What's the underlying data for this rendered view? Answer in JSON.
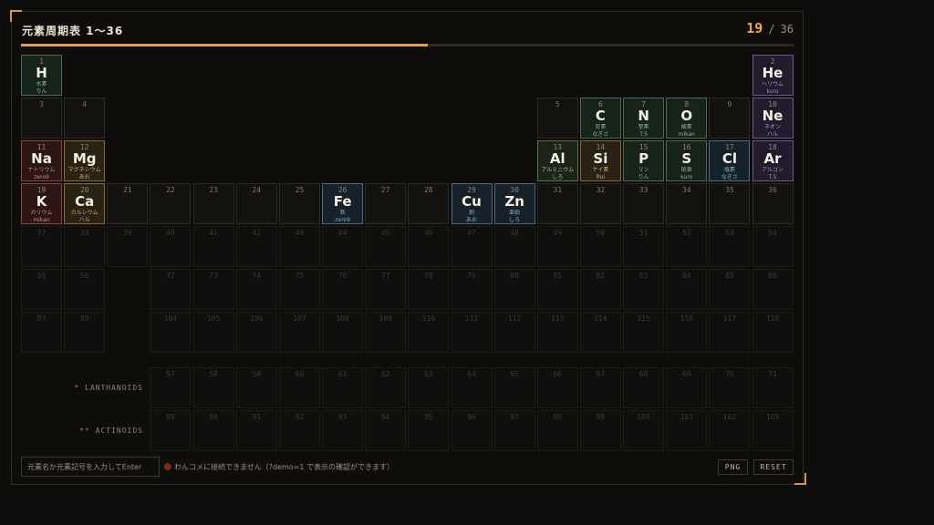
{
  "header": {
    "title": "元素周期表 1〜36",
    "counter_current": "19",
    "counter_sep": "/",
    "counter_total": "36",
    "progress": 0.527
  },
  "colors": {
    "accent": "#e2a24e",
    "nonmetal": "#4a6b52",
    "noble": "#6a5a8a",
    "alkali": "#8a4840",
    "alkaline": "#8a6c3a",
    "transition": "#4e6880",
    "halogen": "#4a7480"
  },
  "elements": [
    {
      "n": "1",
      "sym": "H",
      "jp": "水素",
      "who": "りん",
      "cat": "nonmetal"
    },
    {
      "n": "2",
      "sym": "He",
      "jp": "ヘリウム",
      "who": "kuro",
      "cat": "noble"
    },
    {
      "n": "3",
      "sym": "",
      "jp": "",
      "who": "",
      "cat": ""
    },
    {
      "n": "4",
      "sym": "",
      "jp": "",
      "who": "",
      "cat": ""
    },
    {
      "n": "5",
      "sym": "",
      "jp": "",
      "who": "",
      "cat": ""
    },
    {
      "n": "6",
      "sym": "C",
      "jp": "炭素",
      "who": "なぎさ",
      "cat": "nonmetal"
    },
    {
      "n": "7",
      "sym": "N",
      "jp": "窒素",
      "who": "T.S",
      "cat": "nonmetal"
    },
    {
      "n": "8",
      "sym": "O",
      "jp": "酸素",
      "who": "mikan",
      "cat": "nonmetal"
    },
    {
      "n": "9",
      "sym": "",
      "jp": "",
      "who": "",
      "cat": ""
    },
    {
      "n": "10",
      "sym": "Ne",
      "jp": "ネオン",
      "who": "ハル",
      "cat": "noble"
    },
    {
      "n": "11",
      "sym": "Na",
      "jp": "ナトリウム",
      "who": "zero9",
      "cat": "alkali"
    },
    {
      "n": "12",
      "sym": "Mg",
      "jp": "マグネシウム",
      "who": "あお",
      "cat": "alkaline"
    },
    {
      "n": "13",
      "sym": "Al",
      "jp": "アルミニウム",
      "who": "しろ",
      "cat": "poor"
    },
    {
      "n": "14",
      "sym": "Si",
      "jp": "ケイ素",
      "who": "Rui",
      "cat": "metalloid"
    },
    {
      "n": "15",
      "sym": "P",
      "jp": "リン",
      "who": "りん",
      "cat": "nonmetal"
    },
    {
      "n": "16",
      "sym": "S",
      "jp": "硫黄",
      "who": "kuro",
      "cat": "nonmetal"
    },
    {
      "n": "17",
      "sym": "Cl",
      "jp": "塩素",
      "who": "なぎさ",
      "cat": "halogen"
    },
    {
      "n": "18",
      "sym": "Ar",
      "jp": "アルゴン",
      "who": "T.S",
      "cat": "noble"
    },
    {
      "n": "19",
      "sym": "K",
      "jp": "カリウム",
      "who": "mikan",
      "cat": "alkali"
    },
    {
      "n": "20",
      "sym": "Ca",
      "jp": "カルシウム",
      "who": "ハル",
      "cat": "alkaline"
    },
    {
      "n": "21",
      "sym": "",
      "jp": "",
      "who": "",
      "cat": ""
    },
    {
      "n": "22",
      "sym": "",
      "jp": "",
      "who": "",
      "cat": ""
    },
    {
      "n": "23",
      "sym": "",
      "jp": "",
      "who": "",
      "cat": ""
    },
    {
      "n": "24",
      "sym": "",
      "jp": "",
      "who": "",
      "cat": ""
    },
    {
      "n": "25",
      "sym": "",
      "jp": "",
      "who": "",
      "cat": ""
    },
    {
      "n": "26",
      "sym": "Fe",
      "jp": "鉄",
      "who": "zero9",
      "cat": "transition"
    },
    {
      "n": "27",
      "sym": "",
      "jp": "",
      "who": "",
      "cat": ""
    },
    {
      "n": "28",
      "sym": "",
      "jp": "",
      "who": "",
      "cat": ""
    },
    {
      "n": "29",
      "sym": "Cu",
      "jp": "銅",
      "who": "あお",
      "cat": "transition"
    },
    {
      "n": "30",
      "sym": "Zn",
      "jp": "亜鉛",
      "who": "しろ",
      "cat": "transition"
    },
    {
      "n": "31",
      "sym": "",
      "jp": "",
      "who": "",
      "cat": ""
    },
    {
      "n": "32",
      "sym": "",
      "jp": "",
      "who": "",
      "cat": ""
    },
    {
      "n": "33",
      "sym": "",
      "jp": "",
      "who": "",
      "cat": ""
    },
    {
      "n": "34",
      "sym": "",
      "jp": "",
      "who": "",
      "cat": ""
    },
    {
      "n": "35",
      "sym": "",
      "jp": "",
      "who": "",
      "cat": ""
    },
    {
      "n": "36",
      "sym": "",
      "jp": "",
      "who": "",
      "cat": ""
    }
  ],
  "dim_rows": [
    [
      "37",
      "38",
      "39",
      "40",
      "41",
      "42",
      "43",
      "44",
      "45",
      "46",
      "47",
      "48",
      "49",
      "50",
      "51",
      "52",
      "53",
      "54"
    ],
    [
      "55",
      "56",
      "",
      "72",
      "73",
      "74",
      "75",
      "76",
      "77",
      "78",
      "79",
      "80",
      "81",
      "82",
      "83",
      "84",
      "85",
      "86"
    ],
    [
      "87",
      "88",
      "",
      "104",
      "105",
      "106",
      "107",
      "108",
      "109",
      "110",
      "111",
      "112",
      "113",
      "114",
      "115",
      "116",
      "117",
      "118"
    ]
  ],
  "lanthanoids": {
    "label": "* LANTHANOIDS",
    "numbers": [
      "57",
      "58",
      "59",
      "60",
      "61",
      "62",
      "63",
      "64",
      "65",
      "66",
      "67",
      "68",
      "69",
      "70",
      "71"
    ]
  },
  "actinoids": {
    "label": "** ACTINOIDS",
    "numbers": [
      "89",
      "90",
      "91",
      "92",
      "93",
      "94",
      "95",
      "96",
      "97",
      "98",
      "99",
      "100",
      "101",
      "102",
      "103"
    ]
  },
  "footer": {
    "search_placeholder": "元素名か元素記号を入力してEnter",
    "status_text": "わんコメに接続できません（?demo=1 で表示の確認ができます）",
    "png_label": "PNG",
    "reset_label": "RESET"
  }
}
